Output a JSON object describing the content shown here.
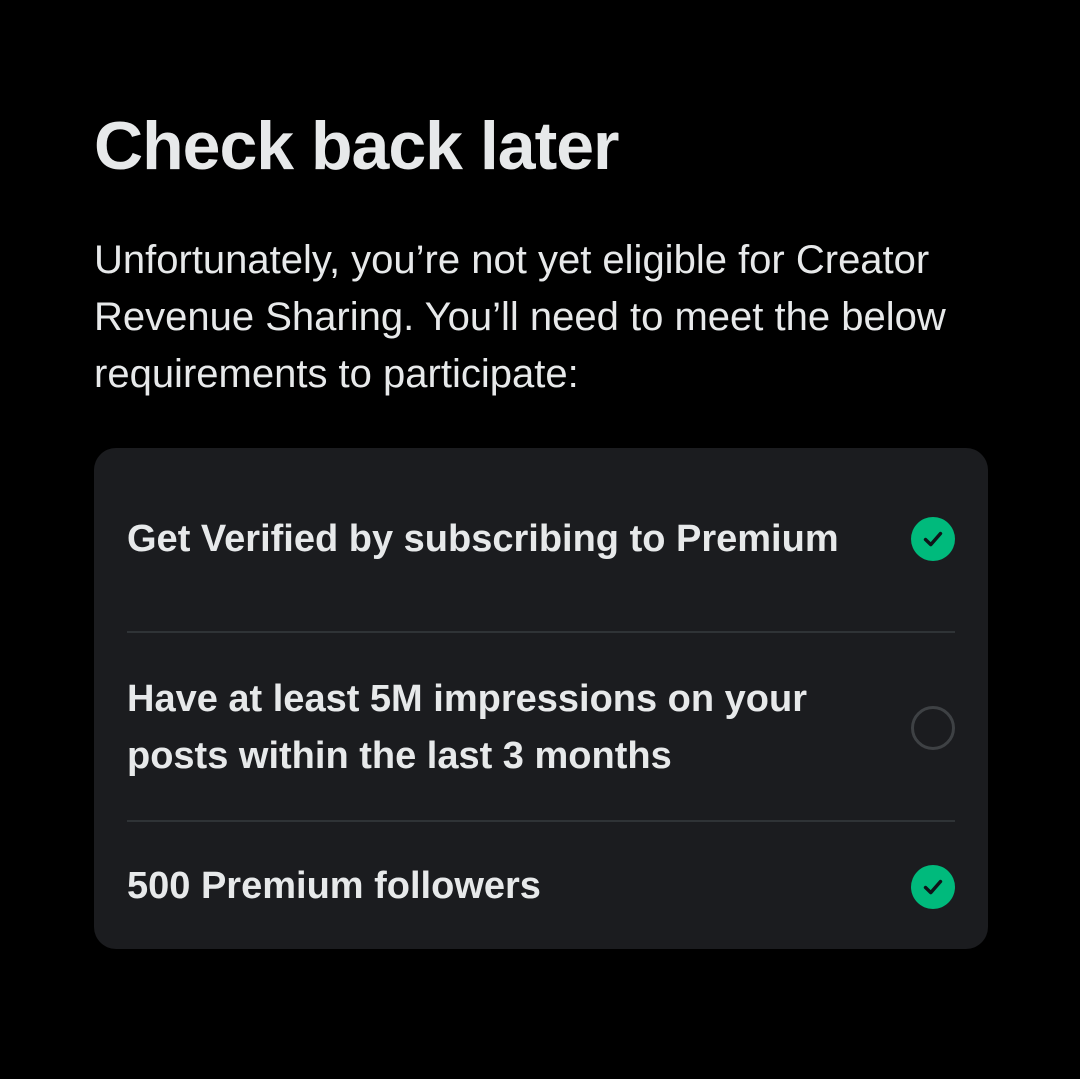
{
  "header": {
    "title": "Check back later",
    "description": "Unfortunately, you’re not yet eligible for Creator Revenue Sharing. You’ll need to meet the below requirements to participate:"
  },
  "requirements": {
    "items": [
      {
        "label": "Get Verified by subscribing to Premium",
        "met": true,
        "icon": "check-circle-icon"
      },
      {
        "label": "Have at least 5M impressions on your posts within the last 3 months",
        "met": false,
        "icon": "empty-circle-icon"
      },
      {
        "label": "500 Premium followers",
        "met": true,
        "icon": "check-circle-icon"
      }
    ]
  },
  "colors": {
    "background": "#000000",
    "card": "#1b1c1f",
    "text": "#e7e9ea",
    "divider": "#2f3336",
    "success": "#00ba7c",
    "pending_outline": "#3e4144"
  }
}
